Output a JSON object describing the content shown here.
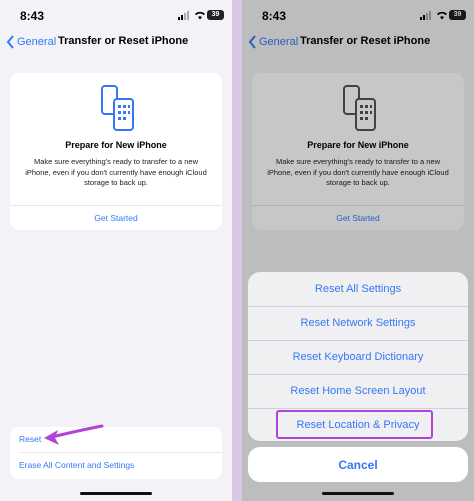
{
  "status": {
    "time": "8:43",
    "battery": "39"
  },
  "nav": {
    "back_label": "General",
    "title": "Transfer or Reset iPhone"
  },
  "prepare_card": {
    "icon": "two-phones-icon",
    "title": "Prepare for New iPhone",
    "description": "Make sure everything's ready to transfer to a new iPhone, even if you don't currently have enough iCloud storage to back up.",
    "button_label": "Get Started"
  },
  "reset_group": {
    "reset_label": "Reset",
    "erase_label": "Erase All Content and Settings"
  },
  "action_sheet": {
    "items": [
      "Reset All Settings",
      "Reset Network Settings",
      "Reset Keyboard Dictionary",
      "Reset Home Screen Layout",
      "Reset Location & Privacy"
    ],
    "cancel_label": "Cancel"
  },
  "colors": {
    "accent": "#3478f6",
    "highlight": "#b044d6"
  }
}
